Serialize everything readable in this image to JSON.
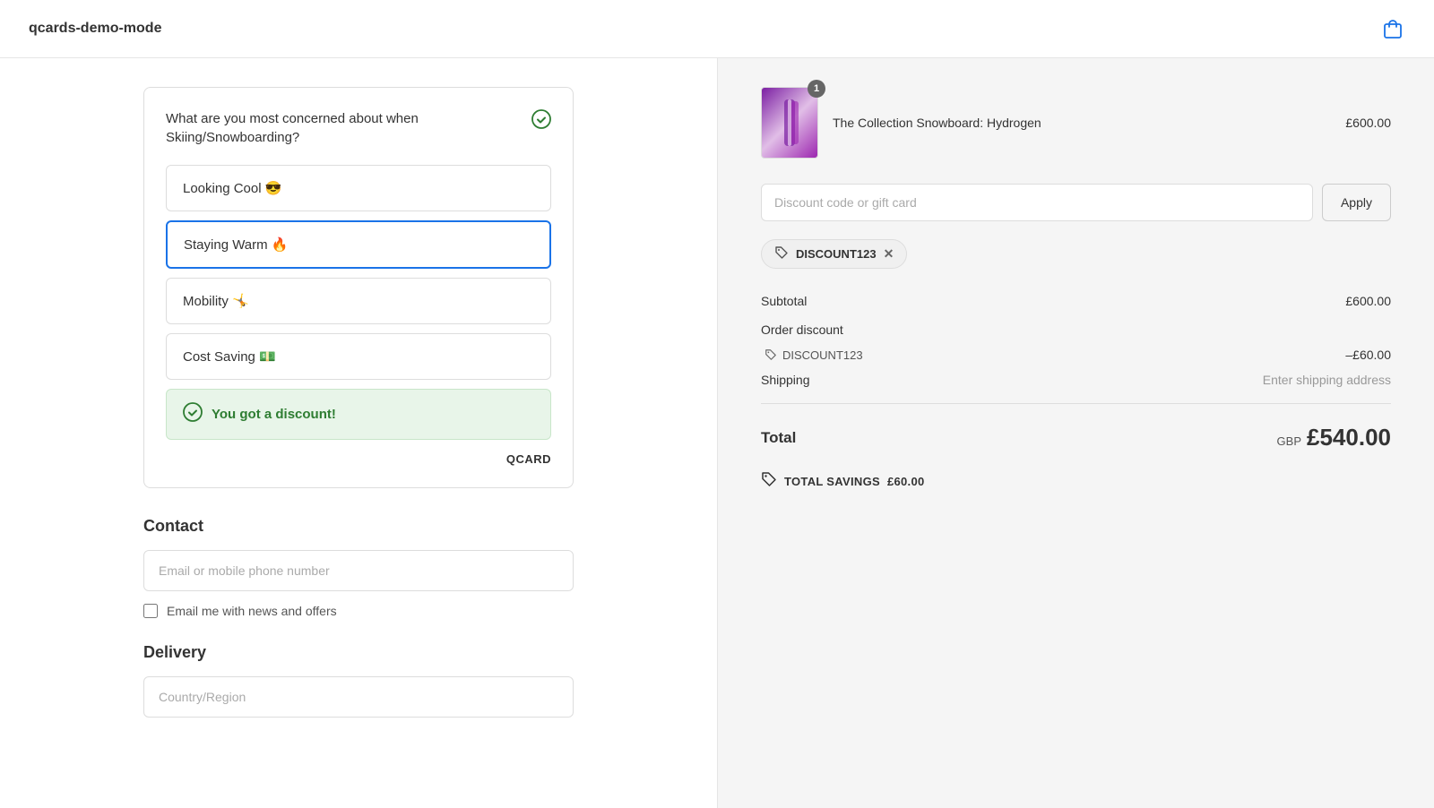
{
  "header": {
    "logo": "qcards-demo-mode",
    "cart_icon_label": "shopping-bag"
  },
  "survey": {
    "question": "What are you most concerned about when Skiing/Snowboarding?",
    "check_icon": "✓",
    "options": [
      {
        "id": "looking-cool",
        "label": "Looking Cool 😎",
        "selected": false
      },
      {
        "id": "staying-warm",
        "label": "Staying Warm 🔥",
        "selected": true
      },
      {
        "id": "mobility",
        "label": "Mobility 🤸",
        "selected": false
      },
      {
        "id": "cost-saving",
        "label": "Cost Saving 💵",
        "selected": false
      }
    ],
    "discount_banner": {
      "text": "You got a discount!",
      "icon": "✓"
    },
    "brand": "QCARD"
  },
  "contact": {
    "title": "Contact",
    "email_placeholder": "Email or mobile phone number",
    "newsletter_label": "Email me with news and offers"
  },
  "delivery": {
    "title": "Delivery",
    "country_placeholder": "Country/Region"
  },
  "order_summary": {
    "product": {
      "name": "The Collection Snowboard: Hydrogen",
      "price": "£600.00",
      "badge": "1"
    },
    "discount_input_placeholder": "Discount code or gift card",
    "apply_button": "Apply",
    "applied_code": "DISCOUNT123",
    "subtotal_label": "Subtotal",
    "subtotal_value": "£600.00",
    "order_discount_label": "Order discount",
    "discount_code_label": "DISCOUNT123",
    "discount_value": "–£60.00",
    "shipping_label": "Shipping",
    "shipping_value": "Enter shipping address",
    "total_label": "Total",
    "total_currency": "GBP",
    "total_amount": "£540.00",
    "savings_label": "TOTAL SAVINGS",
    "savings_amount": "£60.00"
  }
}
